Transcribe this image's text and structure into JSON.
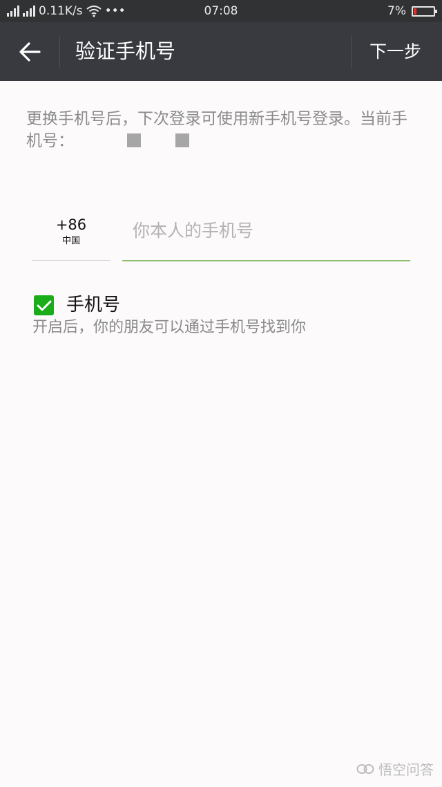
{
  "status_bar": {
    "speed": "0.11K/s",
    "more": "•••",
    "time": "07:08",
    "battery": "7%",
    "battery_level": 0.07
  },
  "header": {
    "title": "验证手机号",
    "next_label": "下一步"
  },
  "description": {
    "text": "更换手机号后，下次登录可使用新手机号登录。当前手机号："
  },
  "phone": {
    "country_code": "+86",
    "country_name": "中国",
    "placeholder": "你本人的手机号",
    "value": ""
  },
  "discoverable": {
    "label": "手机号",
    "hint": "开启后，你的朋友可以通过手机号找到你",
    "checked": true
  },
  "watermark": {
    "text": "悟空问答"
  },
  "colors": {
    "accent_green": "#1aad19",
    "header_bg": "#393a3f",
    "status_bg": "#303234"
  }
}
